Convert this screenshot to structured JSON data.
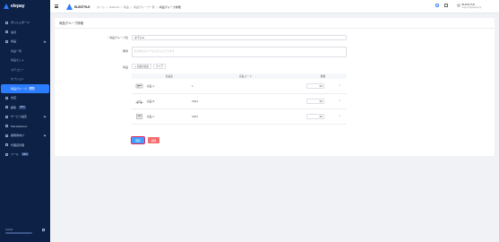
{
  "app": {
    "logo_text": "elepay"
  },
  "sidebar": {
    "items": [
      {
        "label": "ダッシュボード"
      },
      {
        "label": "決済"
      },
      {
        "label": "商品"
      },
      {
        "label": "支店"
      },
      {
        "label": "顧客",
        "badge": "BETA"
      },
      {
        "label": "サービス設定"
      },
      {
        "label": "Marketplace"
      },
      {
        "label": "開発者向け"
      },
      {
        "label": "代理店管理"
      },
      {
        "label": "ツール",
        "badge": "BETA"
      }
    ],
    "sub_items": [
      {
        "label": "商品一覧"
      },
      {
        "label": "商品セット"
      },
      {
        "label": "カテゴリー"
      },
      {
        "label": "オプション"
      },
      {
        "label": "商品グループ",
        "badge": "NEW"
      }
    ],
    "footer_label": "Global"
  },
  "header": {
    "brand": "ELESTYLE",
    "breadcrumbs": [
      "ホーム",
      "Default",
      "商品",
      "商品グループ一覧",
      "商品グループ詳細"
    ],
    "user_name": "ELESTYLE",
    "user_email": "support@elestyle.jp"
  },
  "page": {
    "title": "商品グループ詳細",
    "form": {
      "group_name_label": "商品グループ名",
      "group_name_value": "ホテルA",
      "note_label": "備考",
      "note_placeholder": "社内向けのメモなどを入力できます",
      "products_label": "商品",
      "add_product_label": "+ 商品を追加",
      "clear_label": "クリア"
    },
    "table": {
      "headers": {
        "name": "商品名",
        "code": "商品コード",
        "qty": "数量"
      },
      "rows": [
        {
          "name": "商品 A",
          "code": "1",
          "qty": "10"
        },
        {
          "name": "商品 B",
          "code": "0004",
          "qty": "10"
        },
        {
          "name": "商品 C",
          "code": "0002",
          "qty": "10"
        }
      ]
    },
    "save_label": "保存",
    "delete_label": "削除"
  }
}
